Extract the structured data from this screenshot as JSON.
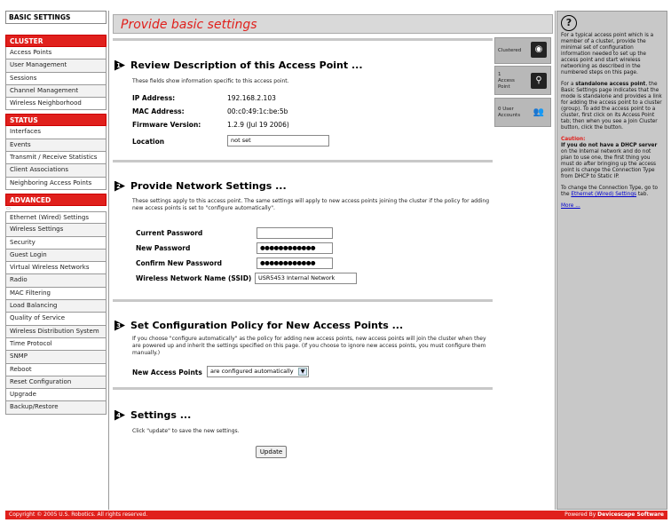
{
  "nav": {
    "top": "BASIC SETTINGS",
    "cluster_head": "CLUSTER",
    "cluster_items": [
      "Access Points",
      "User Management",
      "Sessions",
      "Channel Management",
      "Wireless Neighborhood"
    ],
    "status_head": "STATUS",
    "status_items": [
      "Interfaces",
      "Events",
      "Transmit / Receive Statistics",
      "Client Associations",
      "Neighboring Access Points"
    ],
    "advanced_head": "ADVANCED",
    "advanced_items": [
      "Ethernet (Wired) Settings",
      "Wireless Settings",
      "Security",
      "Guest Login",
      "Virtual Wireless Networks",
      "Radio",
      "MAC Filtering",
      "Load Balancing",
      "Quality of Service",
      "Wireless Distribution System",
      "Time Protocol",
      "SNMP",
      "Reboot",
      "Reset Configuration",
      "Upgrade",
      "Backup/Restore"
    ]
  },
  "page": {
    "title": "Provide basic settings"
  },
  "section1": {
    "num": "1",
    "title": "Review Description of this Access Point ...",
    "desc": "These fields show information specific to this access point.",
    "ip_label": "IP Address:",
    "ip_value": "192.168.2.103",
    "mac_label": "MAC Address:",
    "mac_value": "00:c0:49:1c:be:5b",
    "fw_label": "Firmware Version:",
    "fw_value": "1.2.9 (Jul 19 2006)",
    "location_label": "Location",
    "location_value": "not set"
  },
  "section2": {
    "num": "2",
    "title": "Provide Network Settings ...",
    "desc": "These settings apply to this access point. The same settings will apply to new access points joining the cluster if the policy for adding new access points is set to \"configure automatically\".",
    "current_pw_label": "Current Password",
    "current_pw_value": "",
    "new_pw_label": "New Password",
    "new_pw_value": "●●●●●●●●●●●●",
    "confirm_pw_label": "Confirm New Password",
    "confirm_pw_value": "●●●●●●●●●●●●",
    "ssid_label": "Wireless Network Name (SSID)",
    "ssid_value": "USR5453 Internal Network"
  },
  "section3": {
    "num": "3",
    "title": "Set Configuration Policy for New Access Points ...",
    "desc": "If you choose \"configure automatically\" as the policy for adding new access points, new access points will join the cluster when they are powered up and inherit the settings specified on this page. (If you choose to ignore new access points, you must configure them manually.)",
    "new_ap_label": "New Access Points",
    "new_ap_value": "are configured automatically"
  },
  "section4": {
    "num": "4",
    "title": "Settings ...",
    "desc": "Click \"update\" to save the new settings.",
    "update_label": "Update"
  },
  "cluster_status": {
    "clustered": "Clustered",
    "access_point": "1\nAccess\nPoint",
    "user_accounts": "0 User\nAccounts"
  },
  "help": {
    "p1": "For a typical access point which is a member of a cluster, provide the minimal set of configuration information needed to set up the access point and start wireless networking as described in the numbered steps on this page.",
    "p2_pre": "For a ",
    "p2_bold": "standalone access point",
    "p2_post": ", the Basic Settings page indicates that the mode is standalone and provides a link for adding the access point to a cluster (group). To add the access point to a cluster, first click on its Access Point tab; then when you see a Join Cluster button, click the button.",
    "caution_title": "Caution:",
    "caution_bold": "If you do not have a DHCP server",
    "caution_text": " on the Internal network and do not plan to use one, the first thing you must do after bringing up the access point is change the Connection Type from DHCP to Static IP.",
    "p4_pre": "To change the Connection Type, go to the ",
    "p4_link": "Ethernet (Wired) Settings",
    "p4_post": " tab.",
    "more": "More ..."
  },
  "footer": {
    "copyright": "Copyright © 2005 U.S. Robotics. All rights reserved.",
    "powered_pre": "Powered By ",
    "powered_brand": "Devicescape Software"
  },
  "colors": {
    "accent_red": "#e0201c",
    "panel_gray": "#c8c8c8"
  }
}
